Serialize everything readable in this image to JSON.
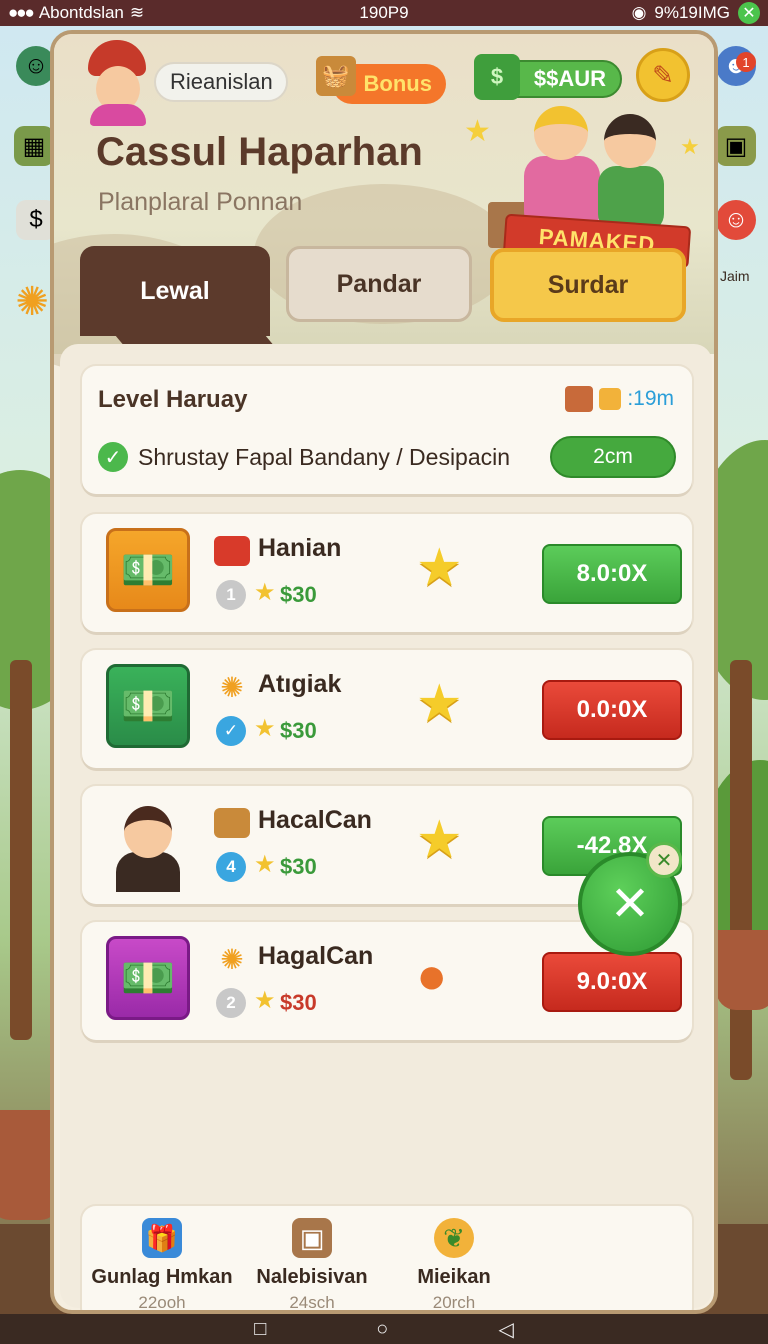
{
  "status_bar": {
    "carrier": "Abontdslan",
    "time": "190P9",
    "right_text": "9%19IMG"
  },
  "side_badge": "1",
  "side_label": "Jaim",
  "header": {
    "username": "Rieanislan",
    "bonus_label": "Bonus",
    "cash_label": "$$AUR",
    "title": "Cassul Haparhan",
    "subtitle": "Planplaral Ponnan",
    "ribbon": "PAMAKED"
  },
  "tabs": [
    {
      "label": "Lewal"
    },
    {
      "label": "Pandar"
    },
    {
      "label": "Surdar"
    }
  ],
  "summary": {
    "title": "Level Haruay",
    "timer": ":19m",
    "description": "Shrustay Fapal Bandany / Desipacin",
    "button": "2cm"
  },
  "items": [
    {
      "name": "Hanian",
      "rank": "1",
      "price": "$30",
      "button": "8.0:0X",
      "button_color": "green",
      "price_color": "green",
      "big_icon": "star"
    },
    {
      "name": "Atıgiak",
      "rank": "✓",
      "price": "$30",
      "button": "0.0:0X",
      "button_color": "red",
      "price_color": "green",
      "big_icon": "star"
    },
    {
      "name": "HacalCan",
      "rank": "4",
      "price": "$30",
      "button": "-42.8X",
      "button_color": "green",
      "price_color": "green",
      "big_icon": "star"
    },
    {
      "name": "HagalCan",
      "rank": "2",
      "price": "$30",
      "button": "9.0:0X",
      "button_color": "red",
      "price_color": "red",
      "big_icon": "drop"
    }
  ],
  "bottom_nav": [
    {
      "label": "Gunlag Hmkan",
      "sub": "22ooh"
    },
    {
      "label": "Nalebisivan",
      "sub": "24sch"
    },
    {
      "label": "Mieikan",
      "sub": "20rch"
    }
  ],
  "colors": {
    "accent_green": "#45a93e",
    "accent_red": "#c62a1e",
    "brown": "#5c3a2c",
    "gold": "#f5c84a"
  }
}
